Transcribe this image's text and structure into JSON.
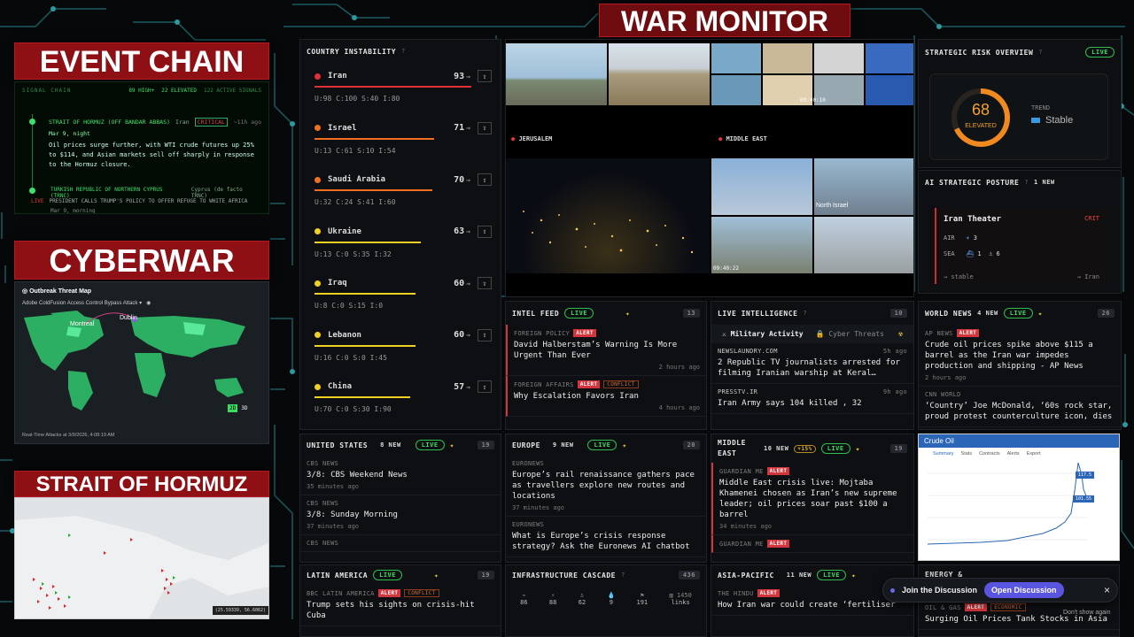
{
  "banners": {
    "event_chain": "EVENT CHAIN",
    "cyberwar": "CYBERWAR",
    "strait": "STRAIT OF HORMUZ",
    "war_monitor": "WAR MONITOR"
  },
  "event_chain": {
    "signal_chain": "SIGNAL CHAIN",
    "stat1": "89 HIGH+",
    "stat2": "22 ELEVATED",
    "stat3": "122 ACTIVE SIGNALS",
    "e1_title": "STRAIT OF HORMUZ (OFF BANDAR ABBAS)",
    "e1_src": "Iran",
    "e1_badge": "CRITICAL",
    "e1_time": "~11h ago",
    "e1_date": "Mar 9, night",
    "e1_text": "Oil prices surge further, with WTI crude futures up 25% to $114, and Asian markets sell off sharply in response to the Hormuz closure.",
    "e2_title": "TURKISH REPUBLIC OF NORTHERN CYPRUS (TRNC)",
    "e2_src": "Cyprus (de facto TRNC)",
    "e3_badge": "LIVE",
    "e3_text": "PRESIDENT CALLS TRUMP'S POLICY TO OFFER REFUGE TO WHITE AFRICA",
    "e3_date": "Mar 9, morning"
  },
  "cyberwar": {
    "title": "Outbreak Threat Map",
    "attack": "Adobe ColdFusion Access Control Bypass Attack",
    "city1": "Dublin",
    "city2": "Montreal",
    "footer": "Real-Time Attacks at 3/9/2026, 4:08:19 AM",
    "btn2d": "2D",
    "btn3d": "3D"
  },
  "strait": {
    "coords": "(25.59339, 56.6062)"
  },
  "instability": {
    "title": "COUNTRY INSTABILITY",
    "rows": [
      {
        "name": "Iran",
        "score": "93",
        "sub": "U:98  C:100  S:40  I:80",
        "color": "#e0303a",
        "bar": 0.93
      },
      {
        "name": "Israel",
        "score": "71",
        "sub": "U:13  C:61  S:10  I:54",
        "color": "#f07020",
        "bar": 0.71
      },
      {
        "name": "Saudi Arabia",
        "score": "70",
        "sub": "U:32  C:24  S:41  I:60",
        "color": "#f07020",
        "bar": 0.7
      },
      {
        "name": "Ukraine",
        "score": "63",
        "sub": "U:13  C:0  S:35  I:32",
        "color": "#f0d020",
        "bar": 0.63
      },
      {
        "name": "Iraq",
        "score": "60",
        "sub": "U:8  C:0  S:15  I:0",
        "color": "#f0d020",
        "bar": 0.6
      },
      {
        "name": "Lebanon",
        "score": "60",
        "sub": "U:16  C:0  S:0  I:45",
        "color": "#f0d020",
        "bar": 0.6
      },
      {
        "name": "China",
        "score": "57",
        "sub": "U:70  C:0  S:30  I:90",
        "color": "#f0d020",
        "bar": 0.57
      }
    ]
  },
  "webcams": {
    "jerusalem": "JERUSALEM",
    "middle_east": "MIDDLE EAST",
    "north_israel": "North Israel",
    "ts1": "09:40:10",
    "ts2": "09:40:22"
  },
  "strategic": {
    "title": "STRATEGIC RISK OVERVIEW",
    "live": "LIVE",
    "score": "68",
    "level": "ELEVATED",
    "trend_label": "TREND",
    "trend": "Stable",
    "score_frac": 0.68
  },
  "posture": {
    "title": "AI STRATEGIC POSTURE",
    "new": "1 NEW",
    "theater": "Iran Theater",
    "crit": "CRIT",
    "air_label": "AIR",
    "air": "3",
    "sea_label": "SEA",
    "sea1": "1",
    "sea2": "6",
    "stable": "→ stable",
    "iran": "→ Iran"
  },
  "intel": {
    "title": "INTEL FEED",
    "live": "LIVE",
    "count": "13",
    "items": [
      {
        "src": "FOREIGN POLICY",
        "badge": "ALERT",
        "conf": "",
        "head": "David Halberstam’s Warning Is More Urgent Than Ever",
        "time": "2 hours ago"
      },
      {
        "src": "FOREIGN AFFAIRS",
        "badge": "ALERT",
        "conf": "CONFLICT",
        "head": "Why Escalation Favors Iran",
        "time": "4 hours ago"
      }
    ]
  },
  "live_intel": {
    "title": "LIVE INTELLIGENCE",
    "count": "10",
    "tab1": "Military Activity",
    "tab2": "Cyber Threats",
    "items": [
      {
        "src": "NEWSLAUNDRY.COM",
        "time": "5h ago",
        "head": "2 Republic TV journalists arrested for filming Iranian warship at Keral…"
      },
      {
        "src": "PRESSTV.IR",
        "time": "9h ago",
        "head": "Iran Army says 104 killed , 32"
      }
    ]
  },
  "world": {
    "title": "WORLD NEWS",
    "new": "4 NEW",
    "live": "LIVE",
    "count": "26",
    "items": [
      {
        "src": "AP NEWS",
        "badge": "ALERT",
        "head": "Crude oil prices spike above $115 a barrel as the Iran war impedes production and shipping - AP News",
        "time": "2 hours ago"
      },
      {
        "src": "CNN WORLD",
        "head": "‘Country’ Joe McDonald, ‘60s rock star, proud protest counterculture icon, dies"
      }
    ]
  },
  "us": {
    "title": "UNITED STATES",
    "new": "8 NEW",
    "live": "LIVE",
    "count": "19",
    "items": [
      {
        "src": "CBS NEWS",
        "head": "3/8: CBS Weekend News",
        "time": "35 minutes ago"
      },
      {
        "src": "CBS NEWS",
        "head": "3/8: Sunday Morning",
        "time": "37 minutes ago"
      },
      {
        "src": "CBS NEWS",
        "head": "",
        "time": ""
      }
    ]
  },
  "europe": {
    "title": "EUROPE",
    "new": "9 NEW",
    "live": "LIVE",
    "count": "20",
    "items": [
      {
        "src": "EURONEWS",
        "head": "Europe’s rail renaissance gathers pace as travellers explore new routes and locations",
        "time": "37 minutes ago"
      },
      {
        "src": "EURONEWS",
        "head": "What is Europe’s crisis response strategy? Ask the Euronews AI chatbot",
        "time": ""
      }
    ]
  },
  "mideast": {
    "title": "MIDDLE EAST",
    "new": "10 NEW",
    "pct": "+15%",
    "live": "LIVE",
    "count": "19",
    "items": [
      {
        "src": "GUARDIAN ME",
        "badge": "ALERT",
        "head": "Middle East crisis live: Mojtaba Khamenei chosen as Iran’s new supreme leader; oil prices soar past $100 a barrel",
        "time": "34 minutes ago"
      },
      {
        "src": "GUARDIAN ME",
        "badge": "ALERT",
        "head": "",
        "time": ""
      }
    ]
  },
  "crude": {
    "title": "Crude Oil",
    "tabs": [
      "Summary",
      "Stats",
      "Contracts",
      "Alerts",
      "Export"
    ],
    "price": "101.55",
    "p2": "117.5"
  },
  "latam": {
    "title": "LATIN AMERICA",
    "live": "LIVE",
    "count": "19",
    "src": "BBC LATIN AMERICA",
    "badge": "ALERT",
    "conf": "CONFLICT",
    "head": "Trump sets his sights on crisis-hit Cuba"
  },
  "infra": {
    "title": "INFRASTRUCTURE CASCADE",
    "count": "436",
    "vals": [
      "86",
      "88",
      "62",
      "9",
      "191"
    ],
    "links_n": "1450",
    "links": "links"
  },
  "asia": {
    "title": "ASIA-PACIFIC",
    "new": "11 NEW",
    "live": "LIVE",
    "src": "THE HINDU",
    "badge": "ALERT",
    "head": "How Iran war could create ‘fertiliser"
  },
  "energy": {
    "title": "ENERGY &",
    "src": "OIL & GAS",
    "badge": "ALERT",
    "eco": "ECONOMIC",
    "head": "Surging Oil Prices Tank Stocks in Asia"
  },
  "discuss": {
    "label": "Join the Discussion",
    "btn": "Open Discussion",
    "close": "×",
    "dont": "Don't show again"
  }
}
